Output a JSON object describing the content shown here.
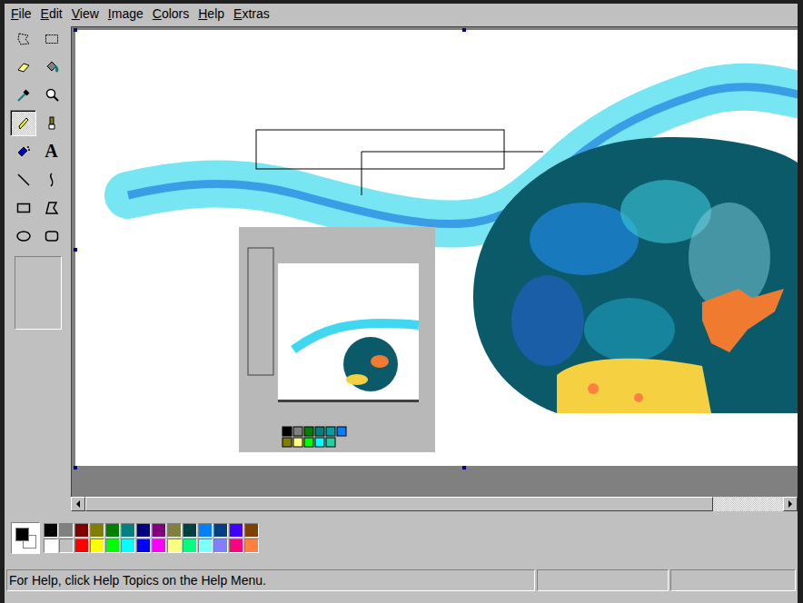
{
  "menu": [
    {
      "label": "File",
      "underline": 0
    },
    {
      "label": "Edit",
      "underline": 0
    },
    {
      "label": "View",
      "underline": 0
    },
    {
      "label": "Image",
      "underline": 0
    },
    {
      "label": "Colors",
      "underline": 0
    },
    {
      "label": "Help",
      "underline": 0
    },
    {
      "label": "Extras",
      "underline": 0
    }
  ],
  "tools": [
    {
      "kind": "free-select",
      "selected": false
    },
    {
      "kind": "select",
      "selected": false
    },
    {
      "kind": "eraser",
      "selected": false
    },
    {
      "kind": "fill",
      "selected": false
    },
    {
      "kind": "picker",
      "selected": false
    },
    {
      "kind": "magnifier",
      "selected": false
    },
    {
      "kind": "pencil",
      "selected": true
    },
    {
      "kind": "brush",
      "selected": false
    },
    {
      "kind": "airbrush",
      "selected": false
    },
    {
      "kind": "text",
      "glyph": "A",
      "selected": false
    },
    {
      "kind": "line",
      "selected": false
    },
    {
      "kind": "curve",
      "selected": false
    },
    {
      "kind": "rectangle",
      "selected": false
    },
    {
      "kind": "polygon",
      "selected": false
    },
    {
      "kind": "ellipse",
      "selected": false
    },
    {
      "kind": "rounded-rectangle",
      "selected": false
    }
  ],
  "current_colors": {
    "foreground": "#000000",
    "background": "#ffffff"
  },
  "palette": [
    {
      "color": "#000000"
    },
    {
      "color": "#808080"
    },
    {
      "color": "#800000"
    },
    {
      "color": "#808000"
    },
    {
      "color": "#008000"
    },
    {
      "color": "#008080"
    },
    {
      "color": "#000080"
    },
    {
      "color": "#800080"
    },
    {
      "color": "#808040"
    },
    {
      "color": "#004040"
    },
    {
      "color": "#0080ff"
    },
    {
      "color": "#004080"
    },
    {
      "color": "#4000ff"
    },
    {
      "color": "#804000"
    },
    {
      "color": "#ffffff"
    },
    {
      "color": "#c0c0c0"
    },
    {
      "color": "#ff0000"
    },
    {
      "color": "#ffff00"
    },
    {
      "color": "#00ff00"
    },
    {
      "color": "#00ffff"
    },
    {
      "color": "#0000ff"
    },
    {
      "color": "#ff00ff"
    },
    {
      "color": "#ffff80"
    },
    {
      "color": "#00ff80"
    },
    {
      "color": "#80ffff"
    },
    {
      "color": "#8080ff"
    },
    {
      "color": "#ff0080"
    },
    {
      "color": "#ff8040"
    }
  ],
  "horizontal_scrollbar": {
    "level": 0.9
  },
  "status_bar": {
    "text": "For Help, click Help Topics on the Help Menu.",
    "panes": [
      "",
      ""
    ]
  }
}
